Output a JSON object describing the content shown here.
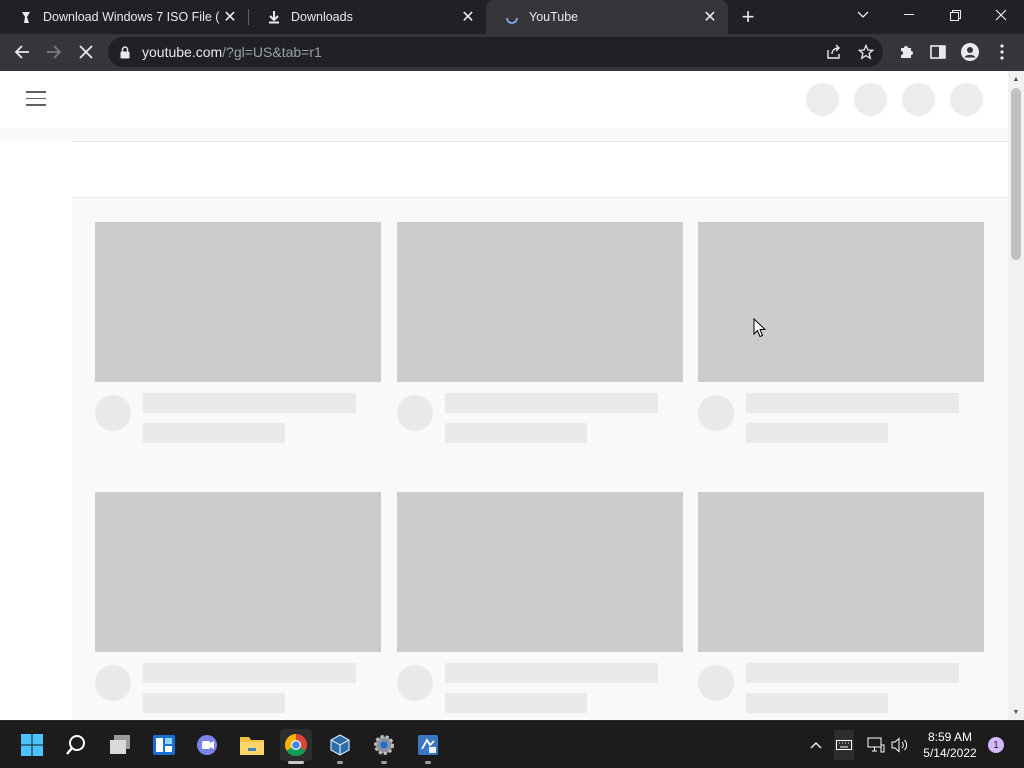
{
  "browser": {
    "tabs": [
      {
        "title": "Download Windows 7 ISO File (U",
        "icon": "site-favicon-icon",
        "active": false
      },
      {
        "title": "Downloads",
        "icon": "download-icon",
        "active": false
      },
      {
        "title": "YouTube",
        "icon": "loading-spinner-icon",
        "active": true
      }
    ],
    "url_host": "youtube.com",
    "url_path": "/?gl=US&tab=r1"
  },
  "page": {
    "masthead_placeholders": 4,
    "skeleton_rows": 2,
    "skeleton_columns": 3,
    "colors": {
      "thumbnail": "#cccccc",
      "placeholder": "#e9e9e9",
      "grid_background": "#f9f9f9"
    }
  },
  "taskbar": {
    "apps": [
      "windows-start-icon",
      "search-icon",
      "task-view-icon",
      "widgets-icon",
      "teams-chat-icon",
      "file-explorer-icon",
      "chrome-icon",
      "virtualbox-icon",
      "settings-icon",
      "app-icon"
    ],
    "time": "8:59 AM",
    "date": "5/14/2022",
    "notification_count": "1"
  }
}
